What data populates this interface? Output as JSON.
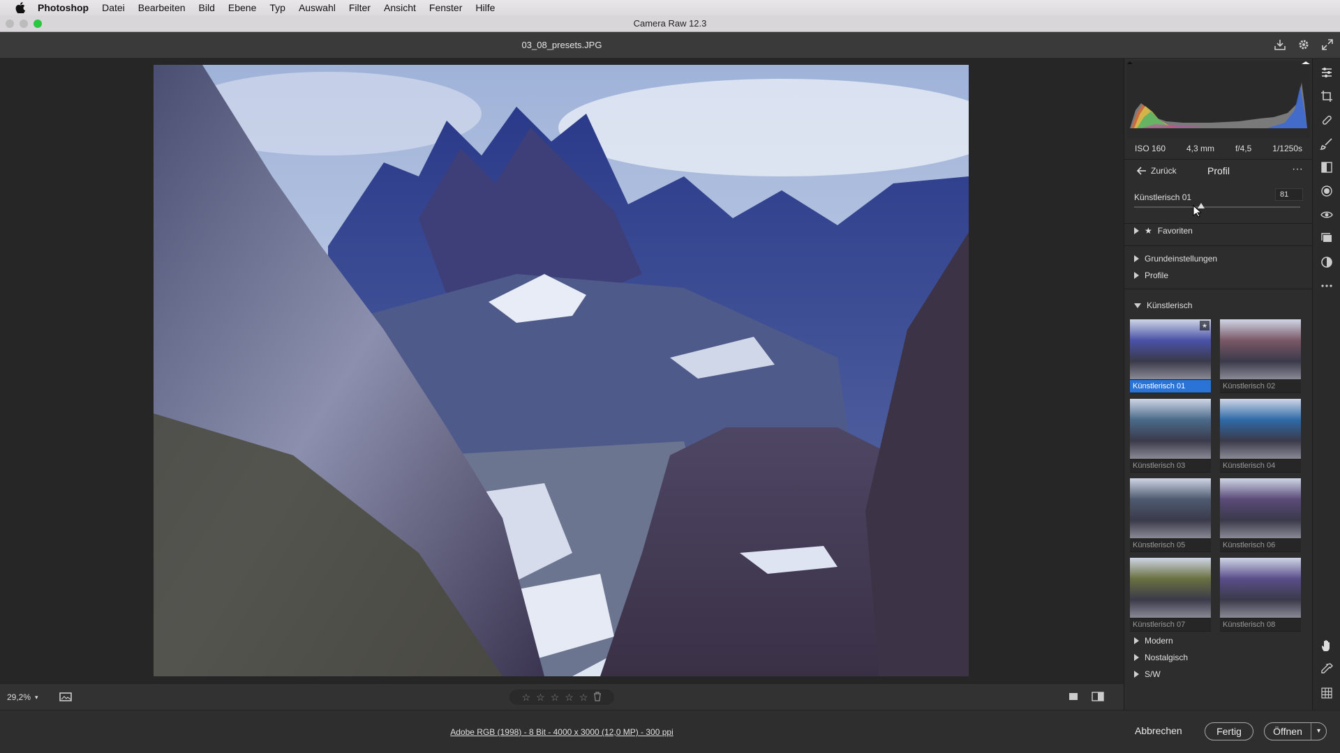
{
  "menubar": {
    "items": [
      "Photoshop",
      "Datei",
      "Bearbeiten",
      "Bild",
      "Ebene",
      "Typ",
      "Auswahl",
      "Filter",
      "Ansicht",
      "Fenster",
      "Hilfe"
    ]
  },
  "window": {
    "title": "Camera Raw 12.3"
  },
  "document": {
    "filename": "03_08_presets.JPG"
  },
  "histogram": {
    "exif": {
      "iso": "ISO 160",
      "focal": "4,3 mm",
      "aperture": "f/4,5",
      "shutter": "1/1250s"
    }
  },
  "profile_panel": {
    "back_label": "Zurück",
    "title": "Profil",
    "more_label": "···",
    "amount": {
      "name": "Künstlerisch 01",
      "value": "81",
      "fraction": 0.405
    },
    "groups_top": [
      {
        "label": "Favoriten",
        "star": "★"
      },
      {
        "label": "Grundeinstellungen"
      },
      {
        "label": "Profile"
      }
    ],
    "expanded_group": "Künstlerisch",
    "presets": [
      {
        "label": "Künstlerisch 01",
        "selected": true,
        "tint": "#4a52a8"
      },
      {
        "label": "Künstlerisch 02",
        "selected": false,
        "tint": "#7a5866"
      },
      {
        "label": "Künstlerisch 03",
        "selected": false,
        "tint": "#4a6a8a"
      },
      {
        "label": "Künstlerisch 04",
        "selected": false,
        "tint": "#2f6aa8"
      },
      {
        "label": "Künstlerisch 05",
        "selected": false,
        "tint": "#4e5a70"
      },
      {
        "label": "Künstlerisch 06",
        "selected": false,
        "tint": "#5a4a78"
      },
      {
        "label": "Künstlerisch 07",
        "selected": false,
        "tint": "#6a7040"
      },
      {
        "label": "Künstlerisch 08",
        "selected": false,
        "tint": "#5a4e8a"
      }
    ],
    "groups_bottom": [
      "Modern",
      "Nostalgisch",
      "S/W"
    ]
  },
  "bottombar": {
    "zoom": "29,2%",
    "stars": [
      "☆",
      "☆",
      "☆",
      "☆",
      "☆"
    ],
    "trash": "🗑"
  },
  "footer": {
    "info": "Adobe RGB (1998) - 8 Bit - 4000 x 3000 (12,0 MP) - 300 ppi",
    "cancel": "Abbrechen",
    "done": "Fertig",
    "open": "Öffnen"
  },
  "colors": {
    "accent": "#2a74d8",
    "panel": "#2d2d2d"
  }
}
